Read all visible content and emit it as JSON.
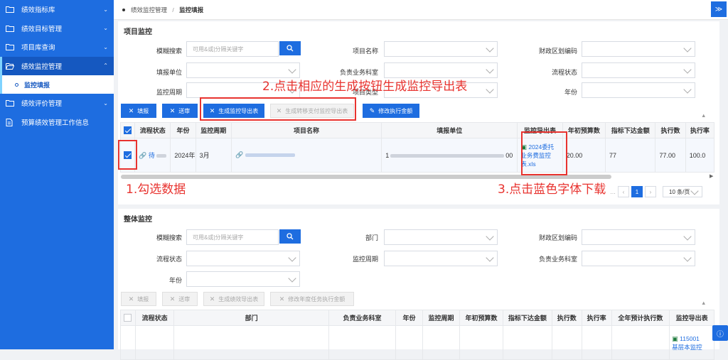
{
  "sidebar": {
    "items": [
      {
        "label": "绩效指标库",
        "icon": "folder-icon"
      },
      {
        "label": "绩效目标管理",
        "icon": "folder-icon"
      },
      {
        "label": "项目库查询",
        "icon": "folder-icon"
      },
      {
        "label": "绩效监控管理",
        "icon": "folder-open-icon"
      },
      {
        "label": "绩效评价管理",
        "icon": "folder-icon"
      },
      {
        "label": "预算绩效管理工作信息",
        "icon": "document-icon"
      }
    ],
    "sub_item": "监控填报"
  },
  "breadcrumb": {
    "parent": "绩效监控管理",
    "separator": "/",
    "current": "监控填报"
  },
  "project_panel": {
    "title": "项目监控",
    "fields": {
      "fuzzy_label": "模糊搜索",
      "fuzzy_placeholder": "可用&或|分隔关键字",
      "project_name_label": "项目名称",
      "region_code_label": "财政区划编码",
      "unit_label": "填报单位",
      "dept_label": "负责业务科室",
      "status_label": "流程状态",
      "period_label": "监控周期",
      "type_label": "项目类型",
      "year_label": "年份"
    },
    "buttons": {
      "fill": "填报",
      "submit": "送审",
      "gen_export": "生成监控导出表",
      "gen_transfer": "生成转移支付监控导出表",
      "edit_exec": "修改执行金额"
    },
    "table": {
      "headers": [
        "流程状态",
        "年份",
        "监控周期",
        "项目名称",
        "填报单位",
        "监控导出表",
        "年初预算数",
        "指标下达金额",
        "执行数",
        "执行率"
      ],
      "row": {
        "status": "待",
        "year": "2024年",
        "period": "3月",
        "unit_prefix": "1",
        "unit_suffix": "00",
        "export_file": "2024委托业务费监控表.xls",
        "budget": "20.00",
        "issued": "77",
        "executed": "77.00",
        "rate": "100.0"
      }
    },
    "pager": {
      "current": "1",
      "page_size": "10 条/页"
    }
  },
  "overall_panel": {
    "title": "整体监控",
    "fields": {
      "fuzzy_label": "模糊搜索",
      "fuzzy_placeholder": "可用&或|分隔关键字",
      "dept_label": "部门",
      "region_code_label": "财政区划编码",
      "status_label": "流程状态",
      "period_label": "监控周期",
      "biz_dept_label": "负责业务科室",
      "year_label": "年份"
    },
    "buttons": {
      "fill": "填报",
      "submit": "送审",
      "gen_perf": "生成绩效导出表",
      "edit_annual": "修改年度任务执行金额"
    },
    "table": {
      "headers": [
        "流程状态",
        "部门",
        "负责业务科室",
        "年份",
        "监控周期",
        "年初预算数",
        "指标下达金额",
        "执行数",
        "执行率",
        "全年预计执行数",
        "监控导出表"
      ],
      "file_partial": "115001",
      "file_partial2": "基层本监控"
    }
  },
  "annotations": {
    "step1": "1.勾选数据",
    "step2": "2.点击相应的生成按钮生成监控导出表",
    "step3": "3.点击蓝色字体下载"
  },
  "colors": {
    "primary": "#1e6de0",
    "annotation": "#e8332f"
  }
}
